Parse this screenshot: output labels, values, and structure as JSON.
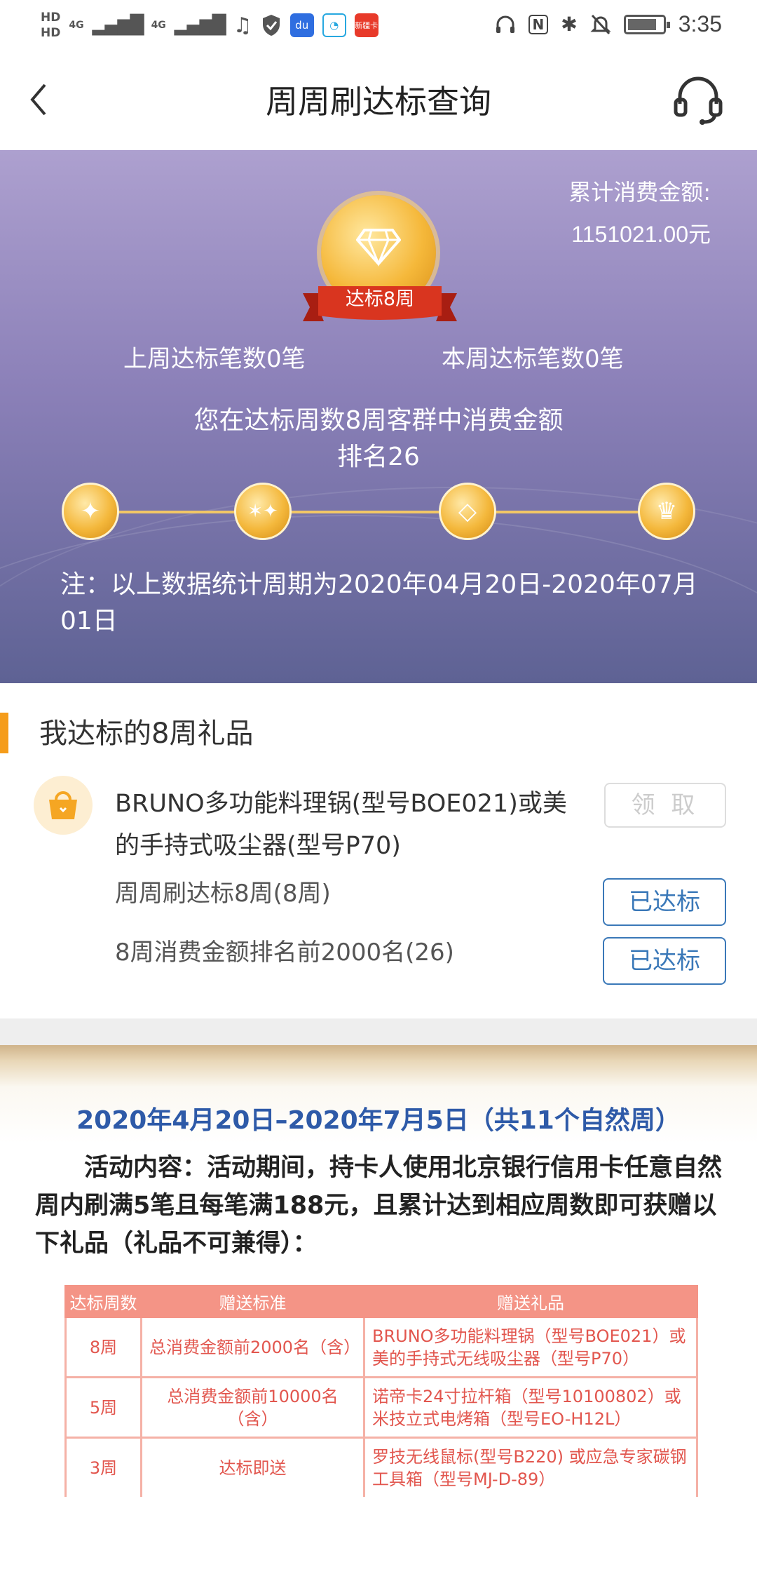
{
  "status_bar": {
    "hd_top": "HD",
    "hd_bottom": "HD",
    "net1": "4G",
    "net2": "4G",
    "badge_text": "新疆卡",
    "time": "3:35"
  },
  "nav": {
    "title": "周周刷达标查询"
  },
  "hero": {
    "total_label": "累计消费金额:",
    "total_value": "1151021.00元",
    "medal_label": "达标8周",
    "last_week": "上周达标笔数0笔",
    "this_week": "本周达标笔数0笔",
    "rank_line1": "您在达标周数8周客群中消费金额",
    "rank_line2": "排名26",
    "note": "注：以上数据统计周期为2020年04月20日-2020年07月01日"
  },
  "gifts": {
    "section_title": "我达标的8周礼品",
    "gift_name": "BRUNO多功能料理锅(型号BOE021)或美的手持式吸尘器(型号P70)",
    "claim_label": "领 取",
    "conditions": [
      {
        "text": "周周刷达标8周(8周)",
        "status": "已达标"
      },
      {
        "text": "8周消费金额排名前2000名(26)",
        "status": "已达标"
      }
    ]
  },
  "rules": {
    "heading": "2020年4月20日–2020年7月5日（共11个自然周）",
    "body": "　　活动内容：活动期间，持卡人使用北京银行信用卡任意自然周内刷满5笔且每笔满188元，且累计达到相应周数即可获赠以下礼品（礼品不可兼得）：",
    "table_headers": [
      "达标周数",
      "赠送标准",
      "赠送礼品"
    ],
    "table_rows": [
      [
        "8周",
        "总消费金额前2000名（含）",
        "BRUNO多功能料理锅（型号BOE021）或美的手持式无线吸尘器（型号P70）"
      ],
      [
        "5周",
        "总消费金额前10000名（含）",
        "诺帝卡24寸拉杆箱（型号10100802）或米技立式电烤箱（型号EO-H12L）"
      ],
      [
        "3周",
        "达标即送",
        "罗技无线鼠标(型号B220) 或应急专家碳钢工具箱（型号MJ-D-89）"
      ]
    ]
  },
  "colors": {
    "accent_orange": "#f59c1a",
    "link_blue": "#3a78b8",
    "hero_top": "#ada0cf",
    "hero_bottom": "#5e6294",
    "table_red": "#e2564e"
  }
}
